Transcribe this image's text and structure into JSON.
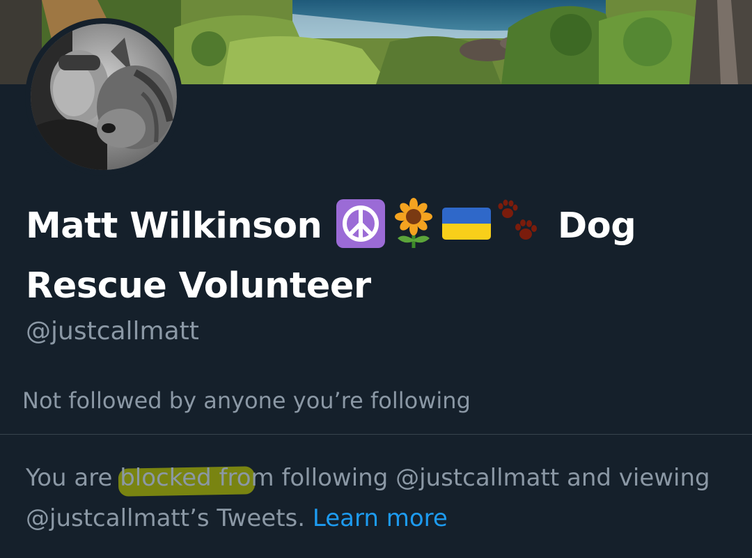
{
  "profile": {
    "name_part1": "Matt Wilkinson",
    "name_part2": "Dog",
    "name_line2": "Rescue Volunteer",
    "handle": "@justcallmatt",
    "followed_by": "Not followed by anyone you’re following"
  },
  "emoji_icons": [
    "peace-symbol-icon",
    "sunflower-icon",
    "ukraine-flag-icon",
    "paw-prints-icon"
  ],
  "blocked": {
    "text_before": "You are blocked from following @justcallmatt and viewing @justcallmatt’s Tweets.",
    "link": "Learn more"
  },
  "colors": {
    "background": "#15202b",
    "text_primary": "#ffffff",
    "text_secondary": "#8b98a5",
    "link": "#1d9bf0",
    "highlight": "#969a0a"
  }
}
